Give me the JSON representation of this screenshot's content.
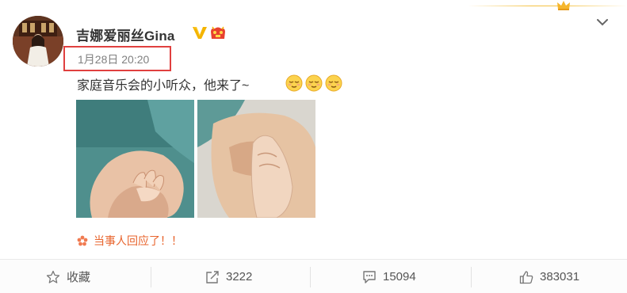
{
  "header": {
    "username": "吉娜爱丽丝Gina",
    "timestamp": "1月28日 20:20",
    "verified_icon": "verified-v-icon",
    "vip_icon": "vip-member-icon",
    "menu_icon": "chevron-down-icon"
  },
  "post": {
    "text": "家庭音乐会的小听众，他来了~",
    "emoji_icon": "sleepy-face-emoji",
    "emoji_count": 3,
    "photos": [
      "baby-hand-photo",
      "holding-hands-photo"
    ]
  },
  "reaction": {
    "label": "当事人回应了！！",
    "icon": "flower-icon"
  },
  "actions": [
    {
      "name": "favorite",
      "icon": "star-icon",
      "label": "收藏"
    },
    {
      "name": "repost",
      "icon": "share-icon",
      "label": "3222"
    },
    {
      "name": "comment",
      "icon": "comment-icon",
      "label": "15094"
    },
    {
      "name": "like",
      "icon": "thumbs-up-icon",
      "label": "383031"
    }
  ],
  "colors": {
    "highlight_border": "#e0403f",
    "reaction_text": "#e8642d",
    "verified_gold": "#f4b400",
    "vip_red": "#e8412f"
  }
}
